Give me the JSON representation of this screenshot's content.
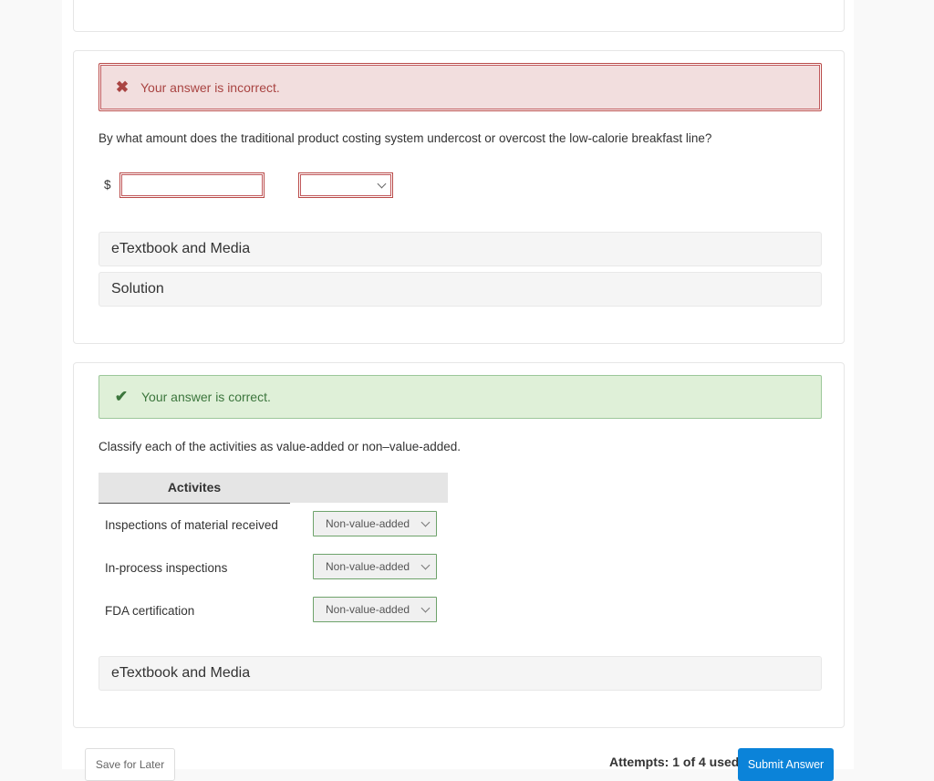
{
  "part_incorrect": {
    "feedback": {
      "icon": "x-mark-icon",
      "text": "Your answer is incorrect.",
      "color": "#a94442",
      "background": "#f2dede"
    },
    "question": "By what amount does the traditional product costing system undercost or overcost the low-calorie breakfast line?",
    "currency_symbol": "$",
    "amount_input": {
      "value": "",
      "placeholder": ""
    },
    "under_over_select": {
      "selected": ""
    },
    "panels": [
      "eTextbook and Media",
      "Solution"
    ]
  },
  "part_correct": {
    "feedback": {
      "icon": "check-mark-icon",
      "text": "Your answer is correct.",
      "color": "#3c763d",
      "background": "#dff0d8"
    },
    "question": "Classify each of the activities as value-added or non–value-added.",
    "table": {
      "header": "Activites",
      "rows": [
        {
          "activity": "Inspections of material received",
          "selected": "Non-value-added"
        },
        {
          "activity": "In-process inspections",
          "selected": "Non-value-added"
        },
        {
          "activity": "FDA certification",
          "selected": "Non-value-added"
        }
      ]
    },
    "panels": [
      "eTextbook and Media"
    ]
  },
  "footer": {
    "save_label": "Save for Later",
    "attempts_text": "Attempts: 1 of 4 used",
    "submit_label": "Submit Answer",
    "submit_color": "#0b83d9"
  }
}
